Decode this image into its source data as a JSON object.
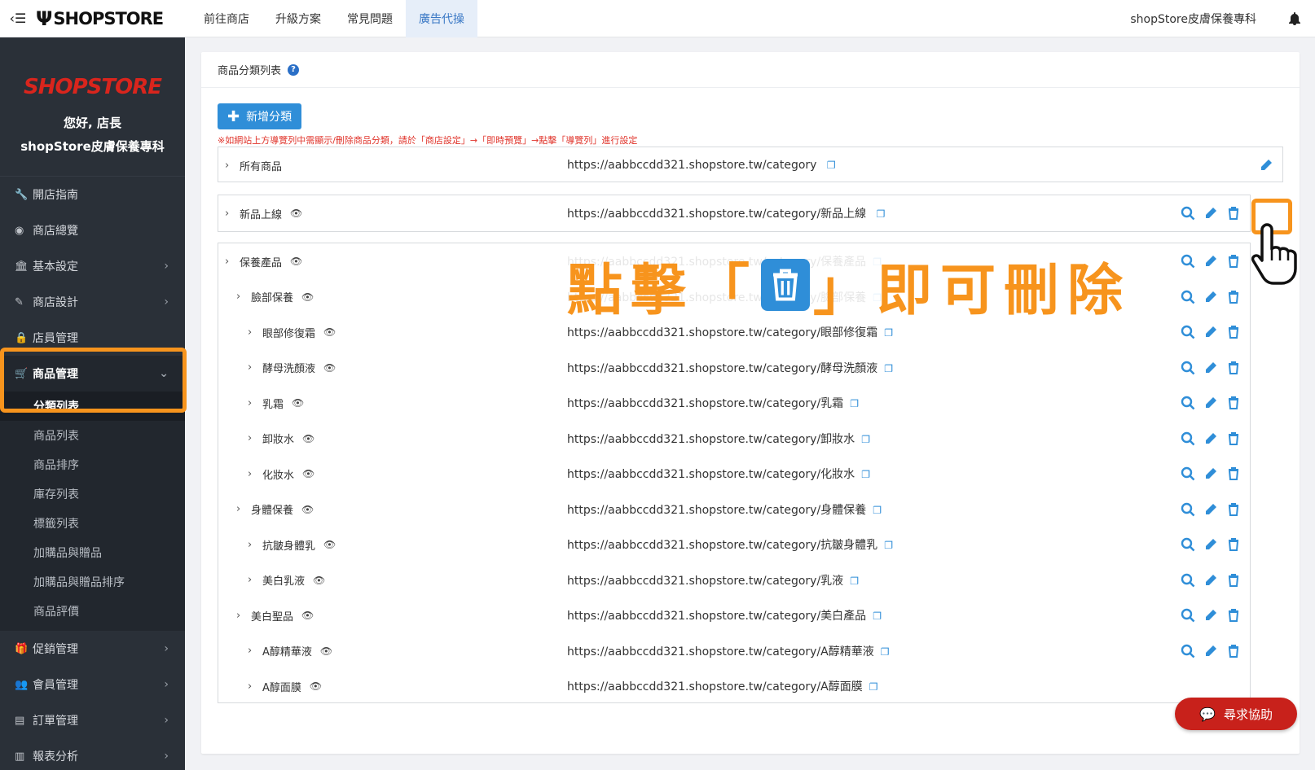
{
  "topbar": {
    "logo_text": "SHOPSTORE",
    "nav": [
      {
        "label": "前往商店",
        "active": false
      },
      {
        "label": "升級方案",
        "active": false
      },
      {
        "label": "常見問題",
        "active": false
      },
      {
        "label": "廣告代操",
        "active": true
      }
    ],
    "store_name": "shopStore皮膚保養專科"
  },
  "sidebar": {
    "brand_logo": "SHOPSTORE",
    "greeting": "您好, 店長",
    "store": "shopStore皮膚保養專科",
    "items": [
      {
        "label": "開店指南",
        "icon": "wrench-icon",
        "chevron": false
      },
      {
        "label": "商店總覽",
        "icon": "dashboard-icon",
        "chevron": false
      },
      {
        "label": "基本設定",
        "icon": "bank-icon",
        "chevron": true
      },
      {
        "label": "商店設計",
        "icon": "magic-wand-icon",
        "chevron": true
      },
      {
        "label": "店員管理",
        "icon": "lock-icon",
        "chevron": false
      },
      {
        "label": "商品管理",
        "icon": "cart-icon",
        "chevron": true,
        "open": true
      }
    ],
    "sub_items": [
      "分類列表",
      "商品列表",
      "商品排序",
      "庫存列表",
      "標籤列表",
      "加購品與贈品",
      "加購品與贈品排序",
      "商品評價"
    ],
    "active_sub": "分類列表",
    "items_after": [
      {
        "label": "促銷管理",
        "icon": "gift-icon"
      },
      {
        "label": "會員管理",
        "icon": "users-icon"
      },
      {
        "label": "訂單管理",
        "icon": "orders-icon"
      },
      {
        "label": "報表分析",
        "icon": "chart-icon"
      }
    ]
  },
  "card": {
    "title": "商品分類列表",
    "add_button": "新增分類",
    "notice": "※如網站上方導覽列中需顯示/刪除商品分類，請於「商店設定」→「即時預覽」→點擊「導覽列」進行設定",
    "rows": [
      {
        "name": "所有商品",
        "url": "https://aabbccdd321.shopstore.tw/category",
        "eye": false,
        "level": 0,
        "actions": "edit"
      },
      {
        "name": "新品上線",
        "url": "https://aabbccdd321.shopstore.tw/category/新品上線",
        "eye": true,
        "level": 0,
        "actions": "all"
      },
      {
        "name": "保養產品",
        "url": "https://aabbccdd321.shopstore.tw/category/保養產品",
        "eye": true,
        "level": 0,
        "actions": "all"
      },
      {
        "name": "臉部保養",
        "url": "https://aabbccdd321.shopstore.tw/category/臉部保養",
        "eye": true,
        "level": 1,
        "actions": "all"
      },
      {
        "name": "眼部修復霜",
        "url": "https://aabbccdd321.shopstore.tw/category/眼部修復霜",
        "eye": true,
        "level": 2,
        "actions": "all"
      },
      {
        "name": "酵母洗顏液",
        "url": "https://aabbccdd321.shopstore.tw/category/酵母洗顏液",
        "eye": true,
        "level": 2,
        "actions": "all"
      },
      {
        "name": "乳霜",
        "url": "https://aabbccdd321.shopstore.tw/category/乳霜",
        "eye": true,
        "level": 2,
        "actions": "all"
      },
      {
        "name": "卸妝水",
        "url": "https://aabbccdd321.shopstore.tw/category/卸妝水",
        "eye": true,
        "level": 2,
        "actions": "all"
      },
      {
        "name": "化妝水",
        "url": "https://aabbccdd321.shopstore.tw/category/化妝水",
        "eye": true,
        "level": 2,
        "actions": "all"
      },
      {
        "name": "身體保養",
        "url": "https://aabbccdd321.shopstore.tw/category/身體保養",
        "eye": true,
        "level": 1,
        "actions": "all"
      },
      {
        "name": "抗皺身體乳",
        "url": "https://aabbccdd321.shopstore.tw/category/抗皺身體乳",
        "eye": true,
        "level": 2,
        "actions": "all"
      },
      {
        "name": "美白乳液",
        "url": "https://aabbccdd321.shopstore.tw/category/乳液",
        "eye": true,
        "level": 2,
        "actions": "all"
      },
      {
        "name": "美白聖品",
        "url": "https://aabbccdd321.shopstore.tw/category/美白產品",
        "eye": true,
        "level": 1,
        "actions": "all"
      },
      {
        "name": "A醇精華液",
        "url": "https://aabbccdd321.shopstore.tw/category/A醇精華液",
        "eye": true,
        "level": 2,
        "actions": "all"
      },
      {
        "name": "A醇面膜",
        "url": "https://aabbccdd321.shopstore.tw/category/A醇面膜",
        "eye": true,
        "level": 2,
        "actions": "none"
      }
    ]
  },
  "annotation": {
    "before": "點擊「",
    "after": "」即可刪除"
  },
  "help_button": "尋求協助",
  "colors": {
    "accent": "#2f8ed8",
    "highlight": "#f7941d",
    "sidebar": "#2a3038",
    "help": "#c8211b"
  }
}
